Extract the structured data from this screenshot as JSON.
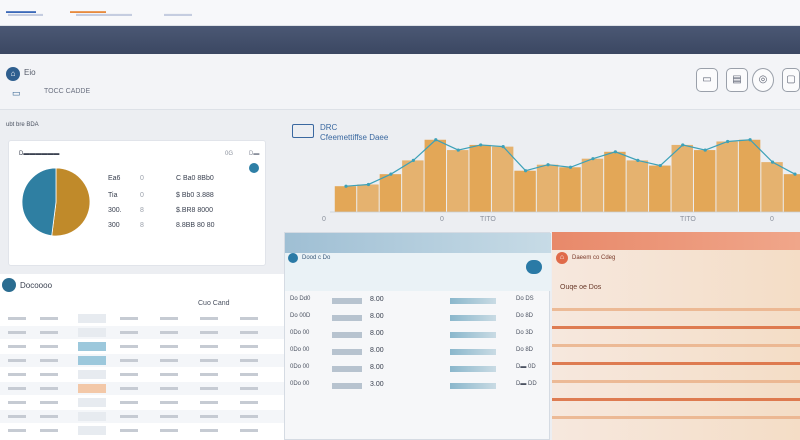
{
  "app": {
    "brand": "▬▬▬▬▬",
    "top_tab": "▬▬▬▬▬▬",
    "nav": [
      "▬▬▬▬▬",
      "▬▬▬▬▬▬▬▬",
      "▬▬▬▬"
    ]
  },
  "subheader": {
    "title": "Eio",
    "caption": "TOCC CADDE",
    "buttons": [
      "▭",
      "▤",
      "◎",
      "▢"
    ]
  },
  "left_label": "ubt bre BDA",
  "pie_panel": {
    "title": "D▬▬▬▬▬▬",
    "headers": [
      "0G",
      "D▬"
    ],
    "rows": [
      {
        "label": "Ea6",
        "mark": "0",
        "value": "C Ba0 8Bb0"
      },
      {
        "label": "Tia",
        "mark": "0",
        "value": "$ Bb0 3.888"
      },
      {
        "label": "300.",
        "mark": "8",
        "value": "$.BR8 8000"
      },
      {
        "label": "300",
        "mark": "8",
        "value": "8.8BB 80 80"
      }
    ],
    "slices": [
      {
        "name": "slice-a",
        "value": 52,
        "color": "#c08a2a"
      },
      {
        "name": "slice-b",
        "value": 48,
        "color": "#2f7fa2"
      }
    ]
  },
  "area_chart": {
    "title": "DRC",
    "subtitle": "Cfeemettiffse Daee",
    "x_labels": [
      "0",
      "0",
      "TITO",
      "TITO",
      "0"
    ],
    "values": [
      30,
      32,
      44,
      60,
      84,
      72,
      78,
      76,
      48,
      55,
      52,
      62,
      70,
      60,
      54,
      78,
      72,
      82,
      84,
      58,
      44
    ],
    "colors": {
      "area": "#e3a24e",
      "line": "#3da1b8"
    }
  },
  "table": {
    "title": "Docoooo",
    "header_label": "Cuo Cand",
    "rows": 9
  },
  "center_panel": {
    "title": "Dood c Do",
    "rows": [
      {
        "a": "Do Dd0",
        "b": "8.00",
        "c": "Do DS"
      },
      {
        "a": "Do 00D",
        "b": "8.00",
        "c": "Do 8D"
      },
      {
        "a": "0Do 00",
        "b": "8.00",
        "c": "Do 3D"
      },
      {
        "a": "0Do 00",
        "b": "8.00",
        "c": "Do 8D"
      },
      {
        "a": "0Do 00",
        "b": "8.00",
        "c": "D▬ 0D"
      },
      {
        "a": "0Do 00",
        "b": "3.00",
        "c": "D▬ DD"
      }
    ]
  },
  "right_panel": {
    "title": "Daeem co Cdeg",
    "subtitle": "Ouqe oe Dos"
  }
}
